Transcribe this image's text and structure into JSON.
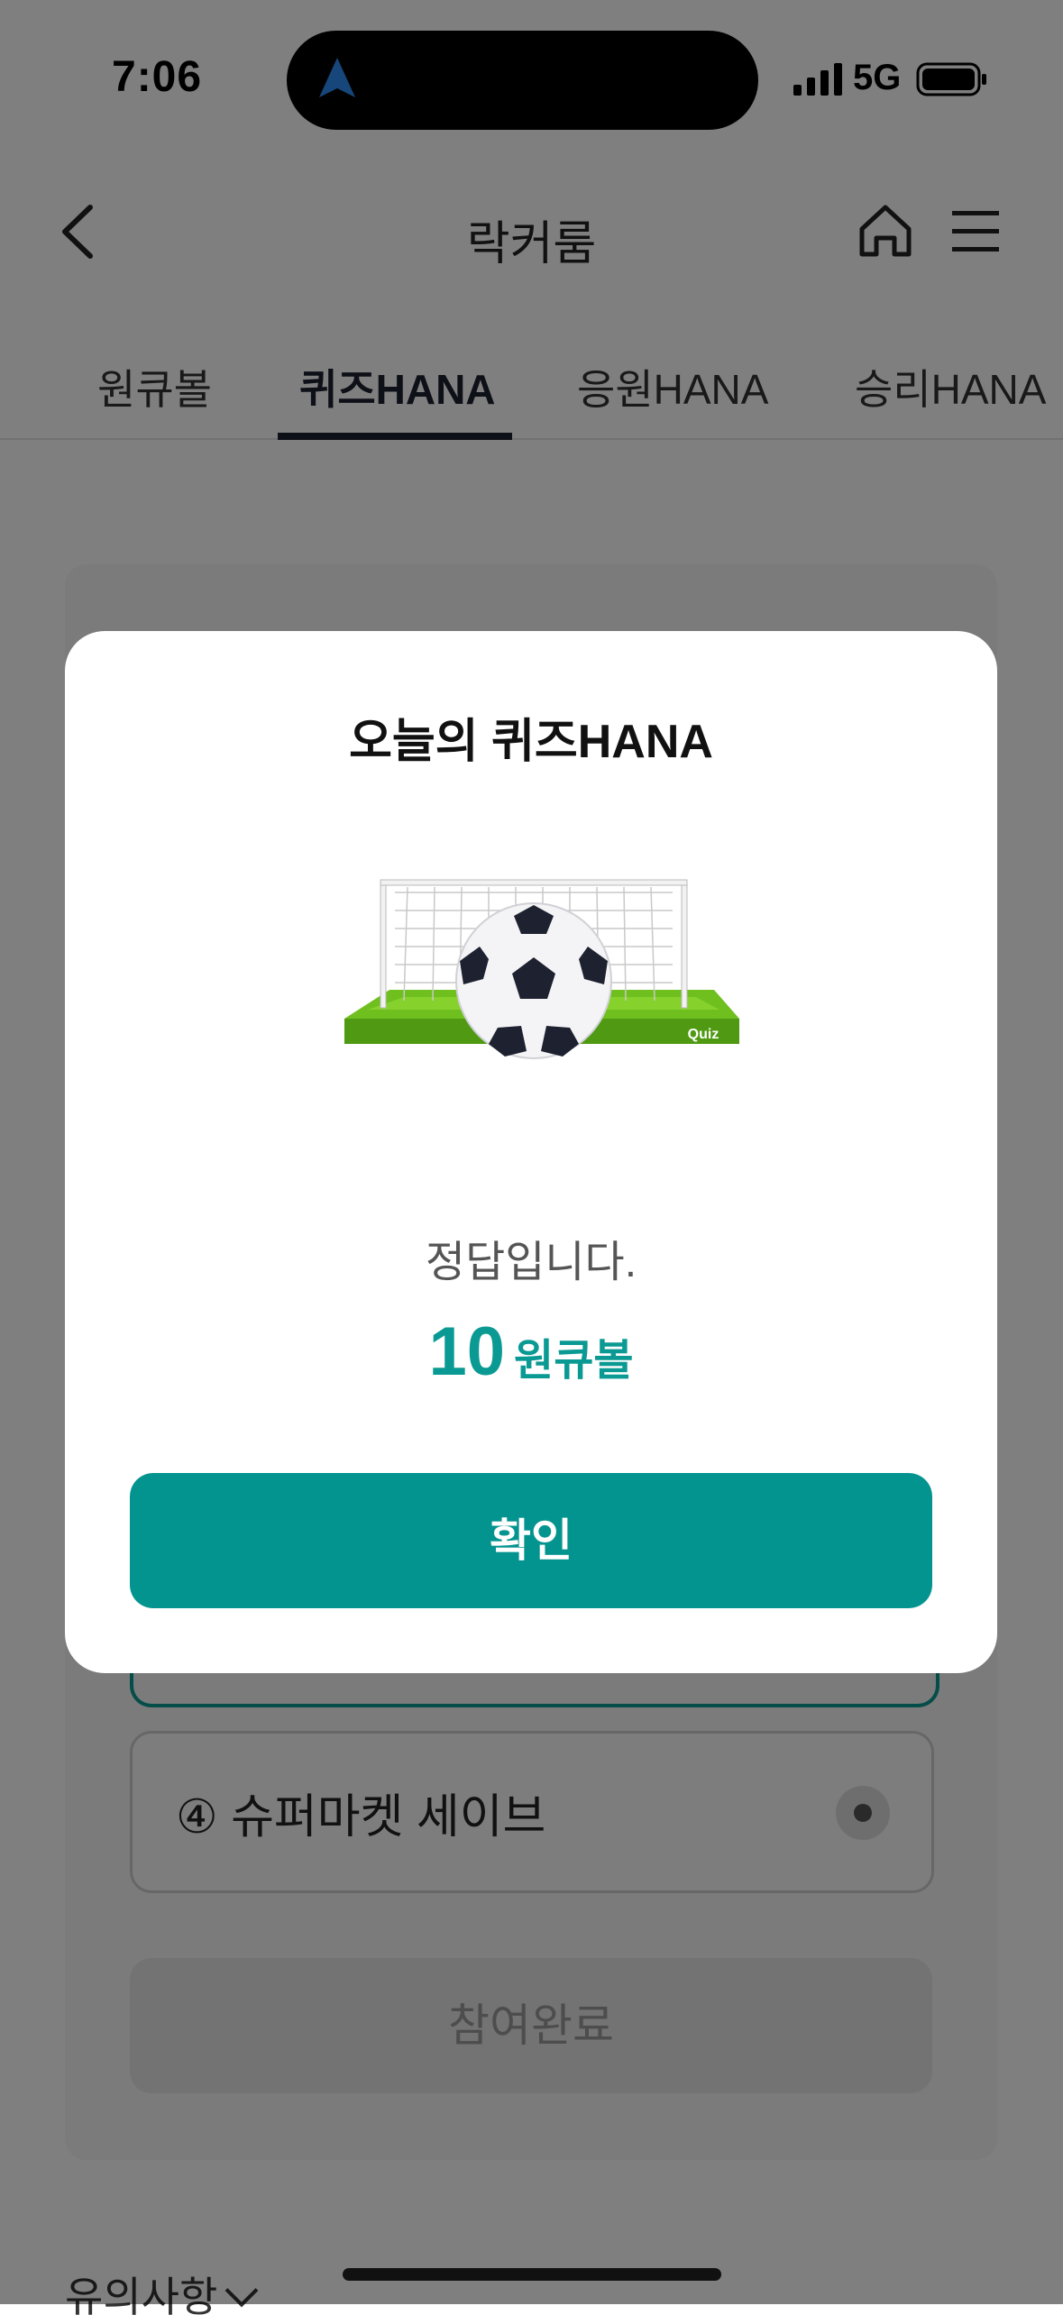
{
  "status_bar": {
    "time": "7:06",
    "network": "5G"
  },
  "header": {
    "title": "락커룸"
  },
  "tabs": [
    {
      "label": "원큐볼",
      "active": false
    },
    {
      "label": "퀴즈HANA",
      "active": true
    },
    {
      "label": "응원HANA",
      "active": false
    },
    {
      "label": "승리HANA",
      "active": false
    }
  ],
  "quiz": {
    "option4": "④ 슈퍼마켓 세이브",
    "submit_label": "참여완료"
  },
  "notice": {
    "label": "유의사항"
  },
  "modal": {
    "title": "오늘의 퀴즈HANA",
    "image_text": "Quiz",
    "message": "정답입니다.",
    "reward_amount": "10",
    "reward_unit": "원큐볼",
    "confirm_label": "확인"
  },
  "colors": {
    "accent": "#04948f",
    "overlay": "rgba(0,0,0,0.5)"
  }
}
